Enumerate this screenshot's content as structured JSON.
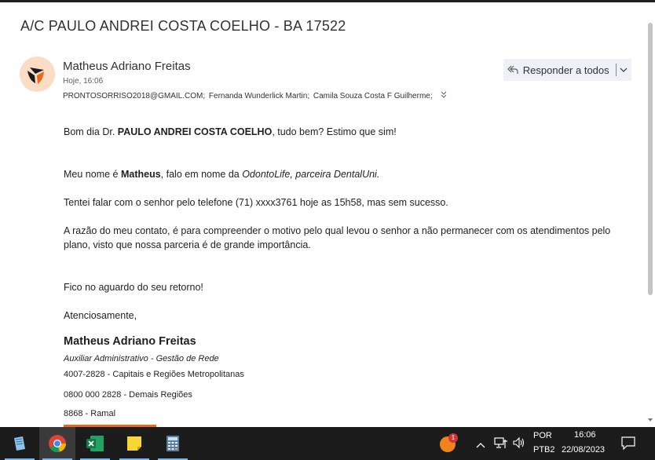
{
  "email": {
    "subject": "A/C PAULO ANDREI COSTA COELHO - BA 17522",
    "sender_name": "Matheus Adriano Freitas",
    "date": "Hoje, 16:06",
    "recipients": [
      "PRONTOSORRISO2018@GMAIL.COM;",
      "Fernanda Wunderlick Martin;",
      "Camila Souza Costa F Guilherme;"
    ],
    "reply_all_label": "Responder a todos"
  },
  "body": {
    "p1_pre": "Bom dia Dr. ",
    "p1_bold": "PAULO ANDREI COSTA COELHO",
    "p1_post": ", tudo bem? Estimo que sim!",
    "p2_pre": "Meu nome é ",
    "p2_bold": "Matheus",
    "p2_mid": ", falo em nome da ",
    "p2_italic": "OdontoLife, parceira DentalUni.",
    "p3": "Tentei falar com o senhor pelo telefone (71) xxxx3761 hoje as 15h58, mas sem sucesso.",
    "p4": "A razão do meu contato, é para compreender o motivo pelo qual levou o senhor a não permanecer com os atendimentos pelo plano, visto que nossa parceria é de grande importância.",
    "p5": "Fico no aguardo do seu retorno!",
    "p6": "Atenciosamente,"
  },
  "signature": {
    "name": "Matheus Adriano Freitas",
    "role": "Auxiliar Administrativo - Gestão de Rede",
    "line1": "4007-2828 - Capitais e Regiões Metropolitanas",
    "line2": "0800 000 2828 - Demais Regiões",
    "line3": "8868 - Ramal"
  },
  "taskbar": {
    "apps": [
      "notepad-icon",
      "chrome-icon",
      "excel-icon",
      "sticky-notes-icon",
      "calculator-icon"
    ],
    "notification_badge": "1",
    "language": "POR",
    "keyboard": "PTB2",
    "time": "16:06",
    "date": "22/08/2023"
  },
  "colors": {
    "accent": "#f0651e",
    "avatar_bg": "#fbdcc4",
    "taskbar": "#1c1c1c"
  }
}
